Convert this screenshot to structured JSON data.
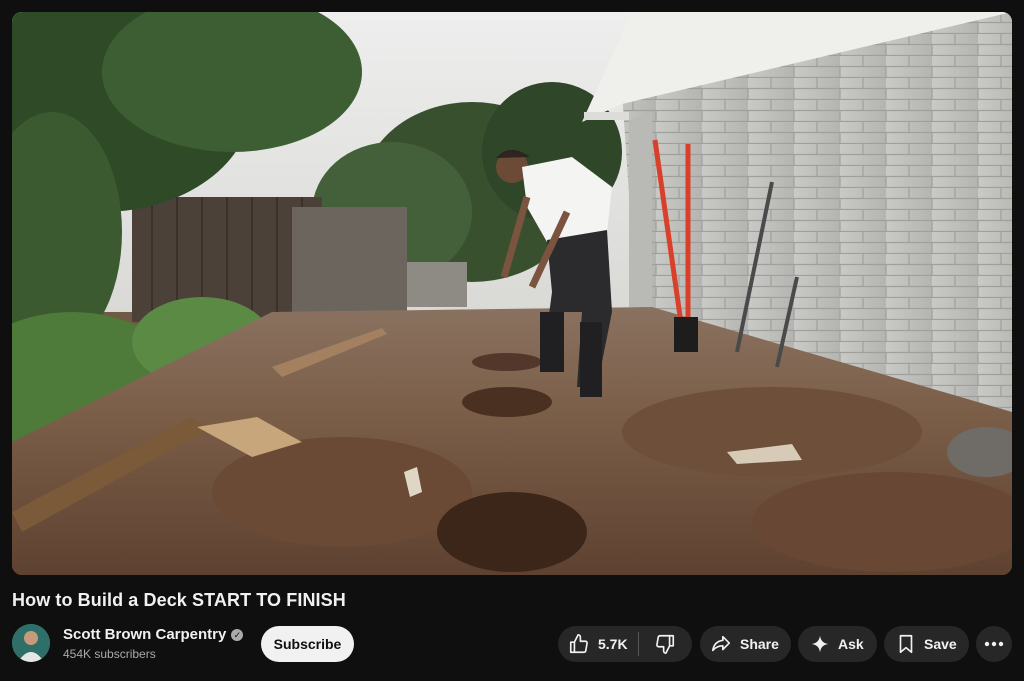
{
  "video": {
    "title": "How to Build a Deck START TO FINISH",
    "thumbnail_description": "man-digging-post-holes-in-backyard"
  },
  "channel": {
    "name": "Scott Brown Carpentry",
    "subscribers": "454K subscribers",
    "verified_icon": "verified-check-icon"
  },
  "actions": {
    "subscribe_label": "Subscribe",
    "like_count": "5.7K",
    "share_label": "Share",
    "ask_label": "Ask",
    "save_label": "Save"
  },
  "colors": {
    "background": "#0f0f0f",
    "pill": "#272727",
    "subscribe_bg": "#f1f1f1",
    "text": "#f1f1f1",
    "secondary_text": "#aaaaaa"
  }
}
